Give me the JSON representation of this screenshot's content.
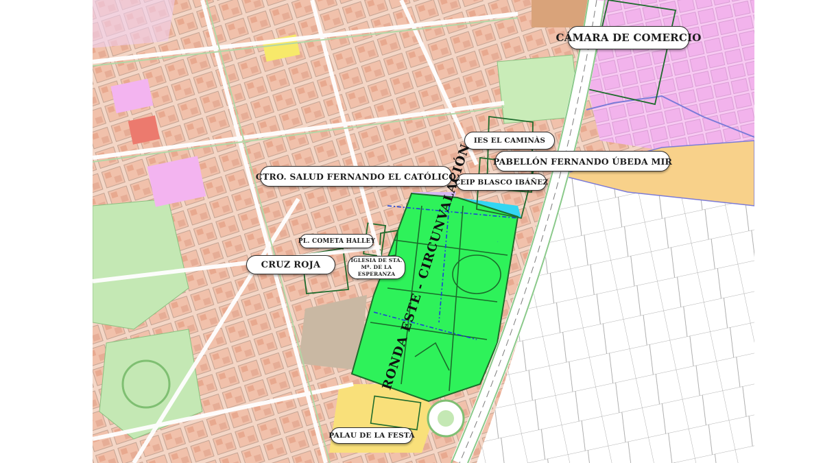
{
  "map": {
    "labels": {
      "camara": "CÁMARA DE COMERCIO",
      "ies": "IES EL CAMINÀS",
      "pabellon": "PABELLÓN FERNANDO ÚBEDA MIR",
      "ctro_salud": "CTRO.  SALUD FERNANDO EL CATÓLICO",
      "ceip": "CEIP BLASCO IBÁÑEZ",
      "cometa": "PL. COMETA HALLEY",
      "cruz_roja": "CRUZ ROJA",
      "iglesia": "IGLESIA DE STA. Mª. DE LA ESPERANZA",
      "palau": "PALAU DE LA FESTA",
      "ronda": "RONDA ESTE - CIRCUNVALACIÓN"
    },
    "colors": {
      "park": "#2ef25a",
      "park_outline": "#1c6b2a",
      "residential": "#f2c6b0",
      "residential_dark": "#e7b39a",
      "green_zone": "#bfe9b2",
      "pink_zone": "#f3b4f0",
      "yellow_zone": "#f9e07a",
      "orange_zone": "#f8d18a",
      "school_blue": "#33d6f2",
      "boundary_green": "#1e6b2c",
      "boundary_blue": "#6b7be0"
    }
  }
}
